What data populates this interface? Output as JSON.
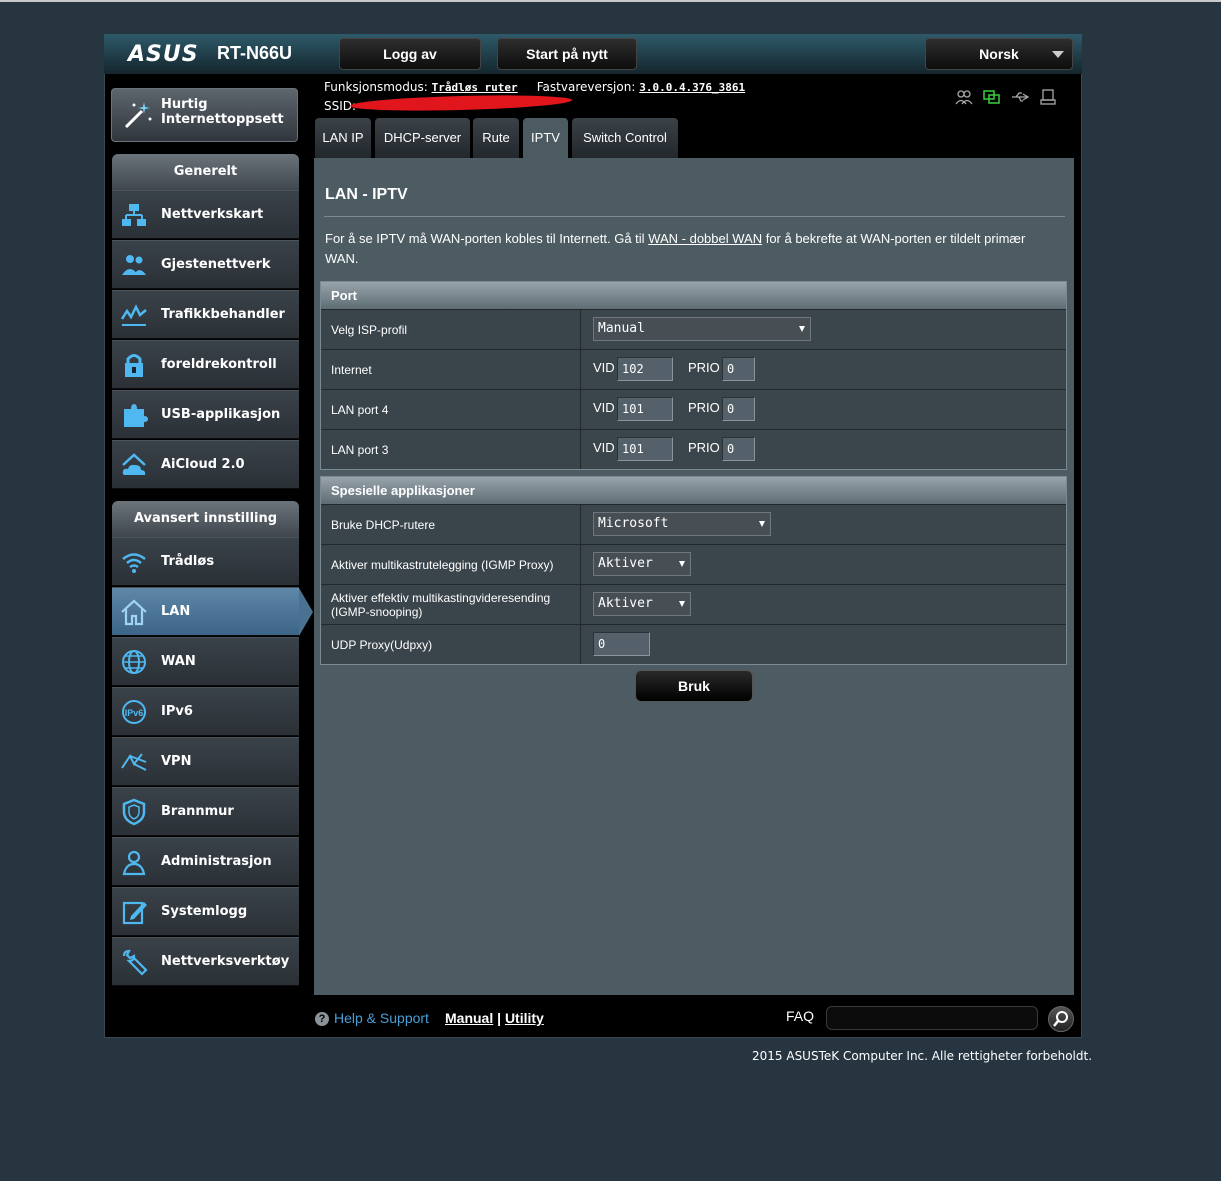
{
  "header": {
    "brand": "ASUS",
    "model": "RT-N66U",
    "logout_label": "Logg av",
    "reboot_label": "Start på nytt",
    "language": "Norsk"
  },
  "info": {
    "mode_label": "Funksjonsmodus:",
    "mode_value": "Trådløs ruter",
    "fw_label": "Fastvareversjon:",
    "fw_value": "3.0.0.4.376_3861",
    "ssid_label": "SSID:"
  },
  "status_icons": [
    "users-icon",
    "network-connected-icon",
    "usb-icon",
    "printer-icon"
  ],
  "quick_setup": {
    "label": "Hurtig Internettoppsett"
  },
  "sidebar": {
    "general_header": "Generelt",
    "general_items": [
      {
        "label": "Nettverkskart",
        "icon": "network-map-icon"
      },
      {
        "label": "Gjestenettverk",
        "icon": "guest-network-icon"
      },
      {
        "label": "Trafikkbehandler",
        "icon": "traffic-manager-icon"
      },
      {
        "label": "foreldrekontroll",
        "icon": "parental-lock-icon"
      },
      {
        "label": "USB-applikasjon",
        "icon": "usb-puzzle-icon"
      },
      {
        "label": "AiCloud 2.0",
        "icon": "cloud-icon"
      }
    ],
    "advanced_header": "Avansert innstilling",
    "advanced_items": [
      {
        "label": "Trådløs",
        "icon": "wifi-icon"
      },
      {
        "label": "LAN",
        "icon": "home-icon"
      },
      {
        "label": "WAN",
        "icon": "globe-icon"
      },
      {
        "label": "IPv6",
        "icon": "ipv6-icon"
      },
      {
        "label": "VPN",
        "icon": "vpn-icon"
      },
      {
        "label": "Brannmur",
        "icon": "shield-icon"
      },
      {
        "label": "Administrasjon",
        "icon": "admin-icon"
      },
      {
        "label": "Systemlogg",
        "icon": "log-icon"
      },
      {
        "label": "Nettverksverktøy",
        "icon": "tools-icon"
      }
    ]
  },
  "tabs": [
    "LAN IP",
    "DHCP-server",
    "Rute",
    "IPTV",
    "Switch Control"
  ],
  "active_tab": "IPTV",
  "page": {
    "title": "LAN - IPTV",
    "desc_pre": "For å se IPTV må WAN-porten kobles til Internett. Gå til ",
    "desc_link": "WAN - dobbel WAN",
    "desc_post": " for å bekrefte at WAN-porten er tildelt primær WAN."
  },
  "port_section": {
    "header": "Port",
    "isp_label": "Velg ISP-profil",
    "isp_value": "Manual",
    "vid_label": "VID",
    "prio_label": "PRIO",
    "rows": [
      {
        "label": "Internet",
        "vid": "102",
        "prio": "0"
      },
      {
        "label": "LAN port 4",
        "vid": "101",
        "prio": "0"
      },
      {
        "label": "LAN port 3",
        "vid": "101",
        "prio": "0"
      }
    ]
  },
  "special_section": {
    "header": "Spesielle applikasjoner",
    "dhcp_label": "Bruke DHCP-rutere",
    "dhcp_value": "Microsoft",
    "igmp_proxy_label": "Aktiver multikastrutelegging (IGMP Proxy)",
    "igmp_proxy_value": "Aktiver",
    "igmp_snoop_label": "Aktiver effektiv multikastingvideresending (IGMP-snooping)",
    "igmp_snoop_value": "Aktiver",
    "udp_label": "UDP Proxy(Udpxy)",
    "udp_value": "0"
  },
  "apply_label": "Bruk",
  "footer": {
    "help": "Help & Support",
    "manual": "Manual",
    "sep": "|",
    "utility": "Utility",
    "faq": "FAQ",
    "copyright": "2015 ASUSTeK Computer Inc. Alle rettigheter forbeholdt."
  },
  "colors": {
    "accent": "#4a9fd8",
    "active_nav": "#4a7191",
    "ssid_redaction": "#e0161c"
  }
}
